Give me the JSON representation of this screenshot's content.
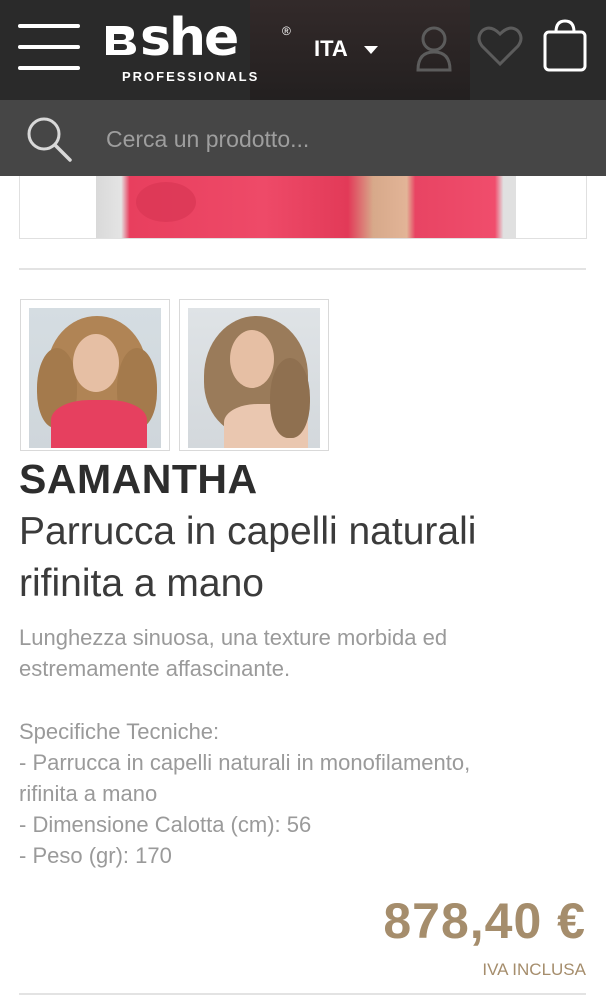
{
  "header": {
    "logo_word": "she",
    "logo_reg": "®",
    "logo_sub": "PROFESSIONALS",
    "language": "ITA",
    "icons": [
      "menu-icon",
      "user-icon",
      "heart-icon",
      "shopping-bag-icon"
    ],
    "background_color": "#2a2a2a"
  },
  "search": {
    "placeholder": "Cerca un prodotto...",
    "value": "",
    "icon": "search-icon",
    "background_color": "#464646"
  },
  "product": {
    "name": "SAMANTHA",
    "subtitle": "Parrucca in capelli naturali rifinita a mano",
    "description": "Lunghezza sinuosa, una texture morbida ed estremamente affascinante.",
    "specs_title": "Specifiche Tecniche:",
    "specs": [
      "- Parrucca in capelli naturali in monofilamento,",
      "rifinita a mano",
      "- Dimensione Calotta (cm): 56",
      "- Peso (gr): 170"
    ],
    "price": "878,40 €",
    "tax_note": "IVA INCLUSA",
    "price_color": "#a58d6c",
    "thumbnails": [
      "thumbnail-front-view",
      "thumbnail-side-view"
    ]
  }
}
